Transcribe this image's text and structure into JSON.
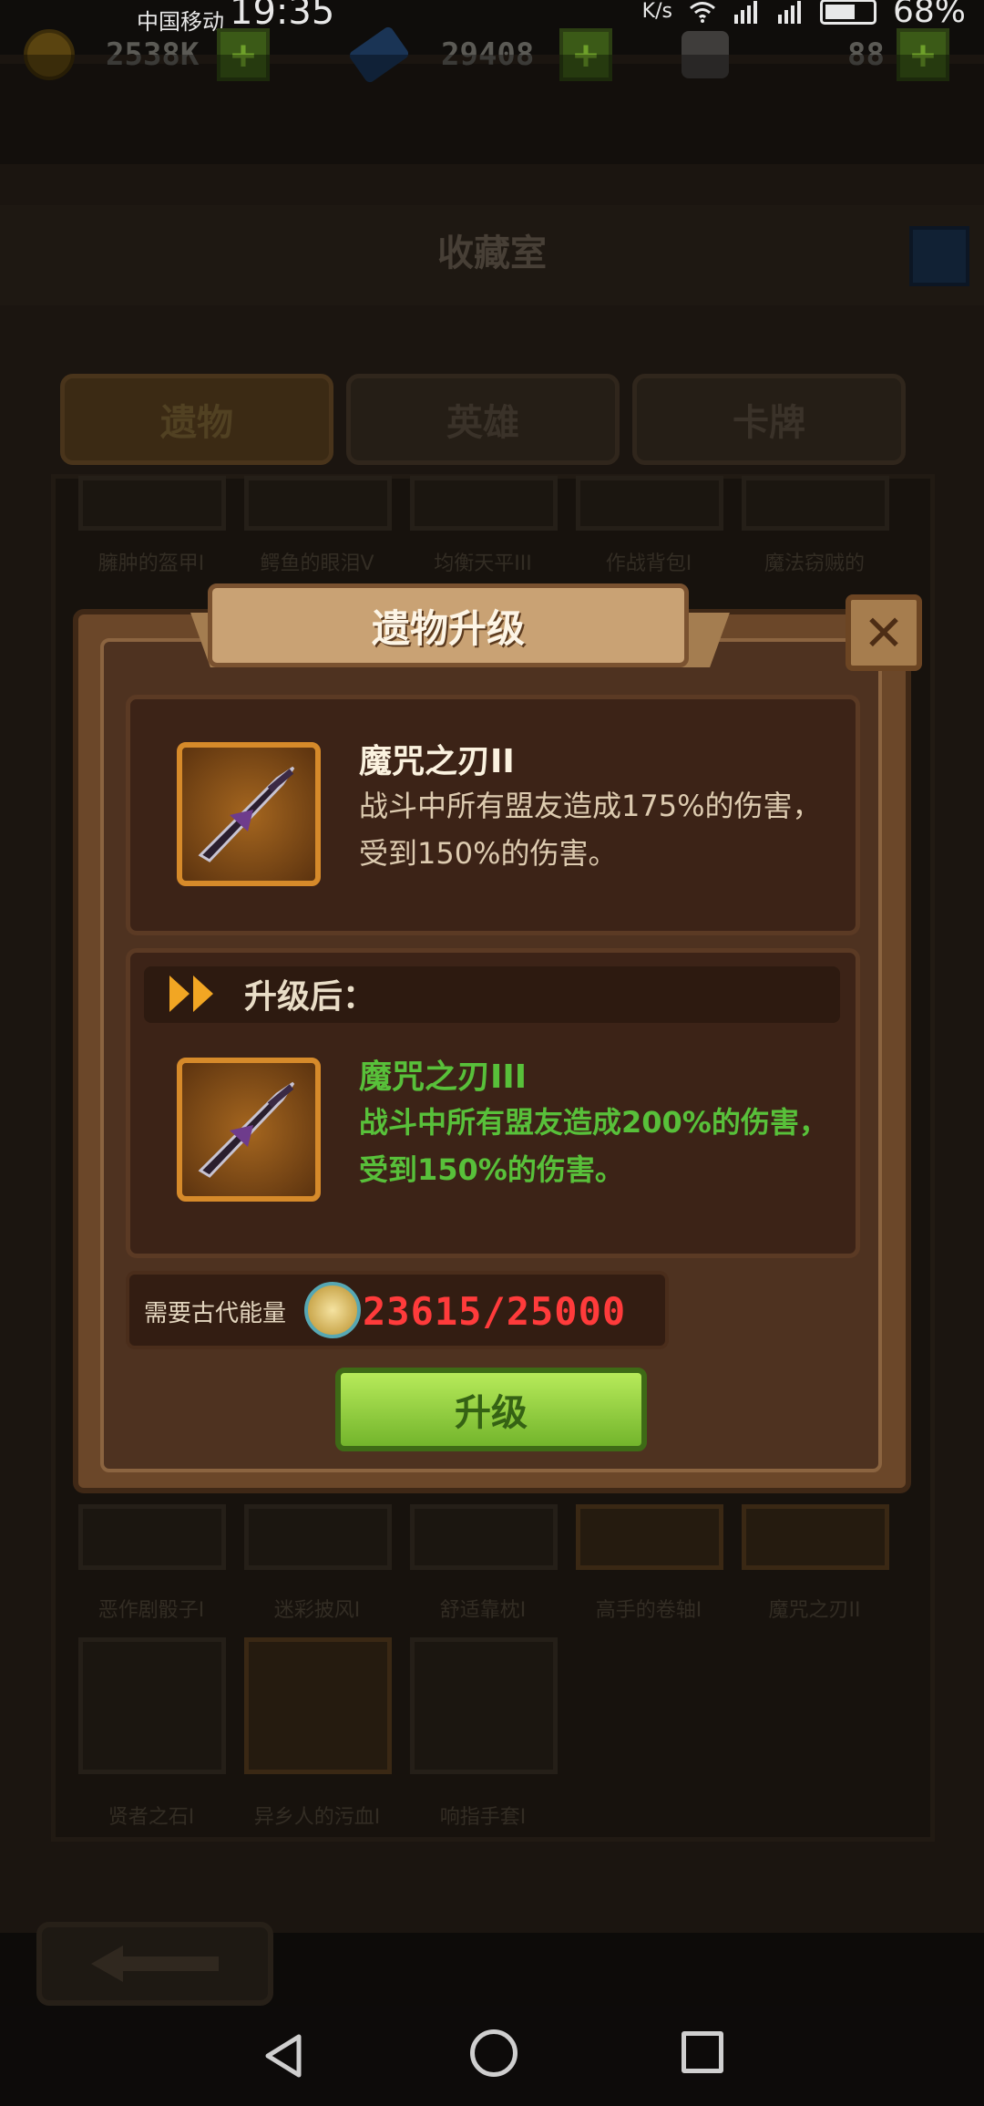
{
  "status_bar": {
    "carrier": "中国移动",
    "time": "19:35",
    "net_speed_unit": "K/s",
    "battery": "68%"
  },
  "resources": {
    "gold": "2538K",
    "gems": "29408",
    "items": "88"
  },
  "page_title": "收藏室",
  "tabs": [
    "遗物",
    "英雄",
    "卡牌"
  ],
  "grid": {
    "row1": [
      "臃肿的盔甲I",
      "鳄鱼的眼泪V",
      "均衡天平III",
      "作战背包I",
      "魔法窃贼的"
    ],
    "row2": [
      "恶作剧骰子I",
      "迷彩披风I",
      "舒适靠枕I",
      "高手的卷轴I",
      "魔咒之刃II"
    ],
    "row3": [
      "贤者之石I",
      "异乡人的污血I",
      "响指手套I"
    ]
  },
  "modal": {
    "title": "遗物升级",
    "current": {
      "name": "魔咒之刃II",
      "description": "战斗中所有盟友造成175%的伤害，受到150%的伤害。"
    },
    "after_label": "升级后：",
    "upgraded": {
      "name": "魔咒之刃III",
      "description": "战斗中所有盟友造成200%的伤害，受到150%的伤害。"
    },
    "cost_label": "需要古代能量",
    "cost_value": "23615/25000",
    "upgrade_button": "升级",
    "close_symbol": "✕"
  },
  "colors": {
    "upgrade_text": "#58c03a",
    "insufficient": "#ff3b3b",
    "button_green": "#8fd03d"
  }
}
